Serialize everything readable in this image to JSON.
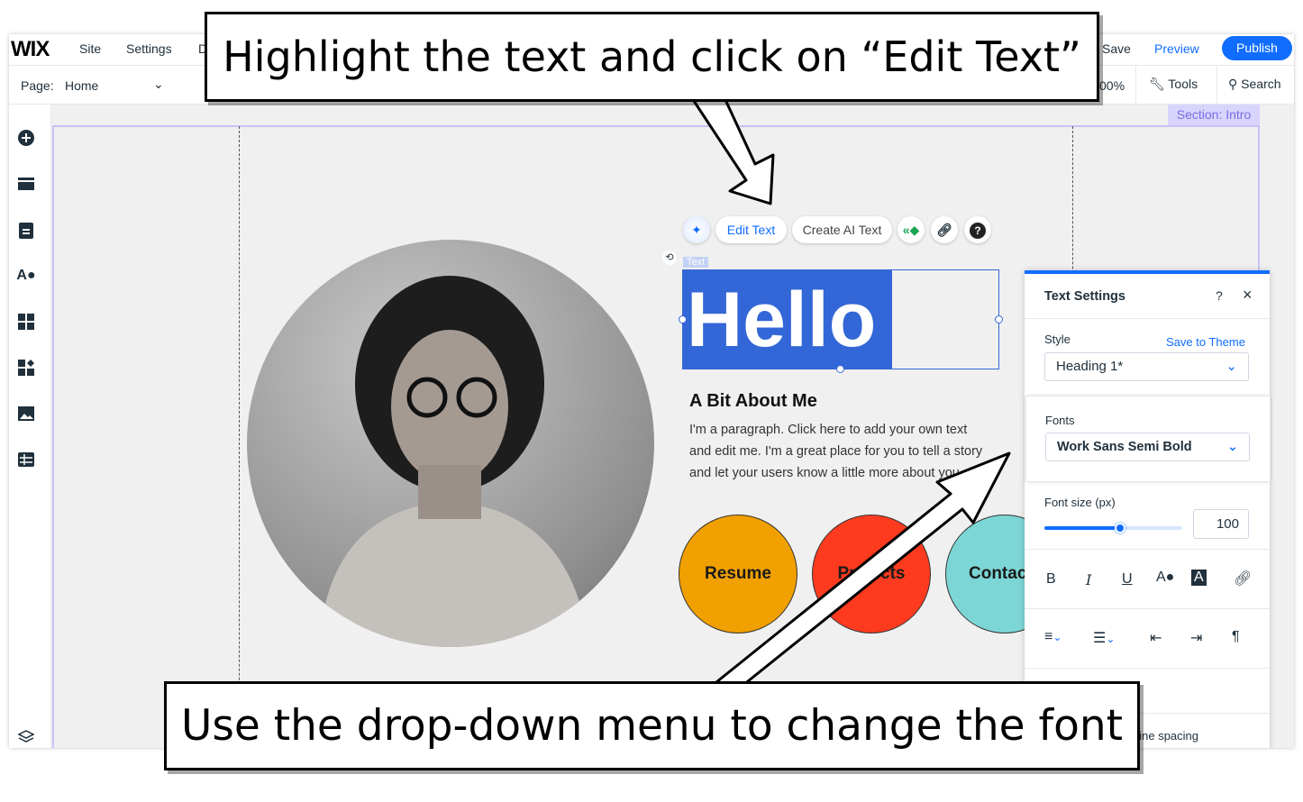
{
  "topbar": {
    "logo": "WIX",
    "site": "Site",
    "settings": "Settings",
    "truncated": "D",
    "save": "Save",
    "preview": "Preview",
    "publish": "Publish"
  },
  "bar2": {
    "page_label": "Page:",
    "page_value": "Home",
    "zoom": "00%",
    "tools": "Tools",
    "search": "Search"
  },
  "sidebar": {
    "icons": [
      "add-icon",
      "sections-icon",
      "pages-icon",
      "design-icon",
      "apps-icon",
      "business-icon",
      "media-icon",
      "cms-icon",
      "layers-icon"
    ]
  },
  "canvas": {
    "section_label": "Section: Intro",
    "toolbar": {
      "edit_text": "Edit Text",
      "create_ai_text": "Create AI Text"
    },
    "text_tag": "Text",
    "heading": "Hello",
    "subheading": "A Bit About Me",
    "paragraph": [
      "I'm a paragraph. Click here to add your own text",
      "and edit me. I'm a great place for you to tell a story",
      "and let your users know a little more about you."
    ],
    "buttons": [
      {
        "label": "Resume",
        "color": "#f0a000"
      },
      {
        "label": "Projects",
        "color": "#ff3b1f"
      },
      {
        "label": "Contact",
        "color": "#7dd6d6"
      }
    ]
  },
  "panel": {
    "title": "Text Settings",
    "help": "?",
    "close": "×",
    "style_label": "Style",
    "save_to_theme": "Save to Theme",
    "style_value": "Heading 1*",
    "fonts_label": "Fonts",
    "font_value": "Work Sans Semi Bold",
    "font_size_label": "Font size (px)",
    "font_size": "100",
    "font_size_slider_fraction": 0.55,
    "cut_label": "Line spacing"
  },
  "callouts": {
    "top": "Highlight the text and click on “Edit Text”",
    "bottom": "Use the drop-down menu to change the font"
  },
  "colors": {
    "accent": "#116dff",
    "selection": "#3366d6"
  }
}
